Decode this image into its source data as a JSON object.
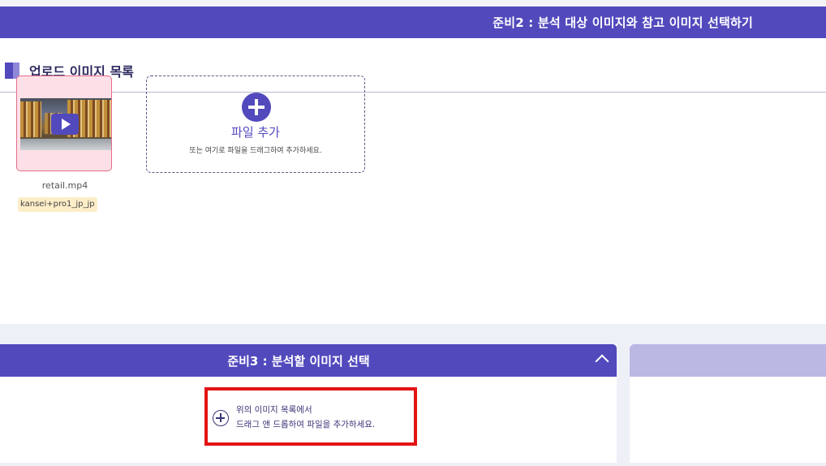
{
  "header": {
    "title": "준비2 : 분석 대상 이미지와 참고 이미지 선택하기"
  },
  "upload_section": {
    "title": "업로드 이미지 목록",
    "items": [
      {
        "filename": "retail.mp4",
        "tag": "kansei+pro1_jp_jp",
        "type": "video"
      }
    ],
    "add_file": {
      "label": "파일 추가",
      "hint": "또는 여기로 파일을 드래그하여 추가하세요."
    }
  },
  "step3": {
    "title": "준비3 : 분석할 이미지 선택",
    "drop_hint_line1": "위의 이미지 목록에서",
    "drop_hint_line2": "드래그 앤 드롭하여 파일을 추가하세요."
  },
  "colors": {
    "accent": "#5249bd",
    "highlight": "#e31414",
    "tag_bg": "#fdeec8",
    "thumb_bg": "#fde0e7"
  },
  "icons": {
    "add": "plus-circle-icon",
    "collapse": "chevron-up-icon",
    "play": "play-icon"
  }
}
